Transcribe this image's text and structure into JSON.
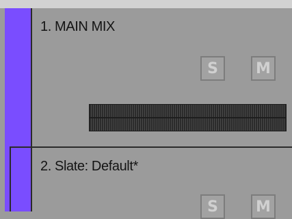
{
  "colors": {
    "lane_color": "#7a4dff",
    "background": "#9b9b9b"
  },
  "tracks": [
    {
      "title": "1. MAIN MIX",
      "solo_label": "S",
      "mute_label": "M"
    },
    {
      "title": "2. Slate: Default*",
      "solo_label": "S",
      "mute_label": "M"
    }
  ]
}
